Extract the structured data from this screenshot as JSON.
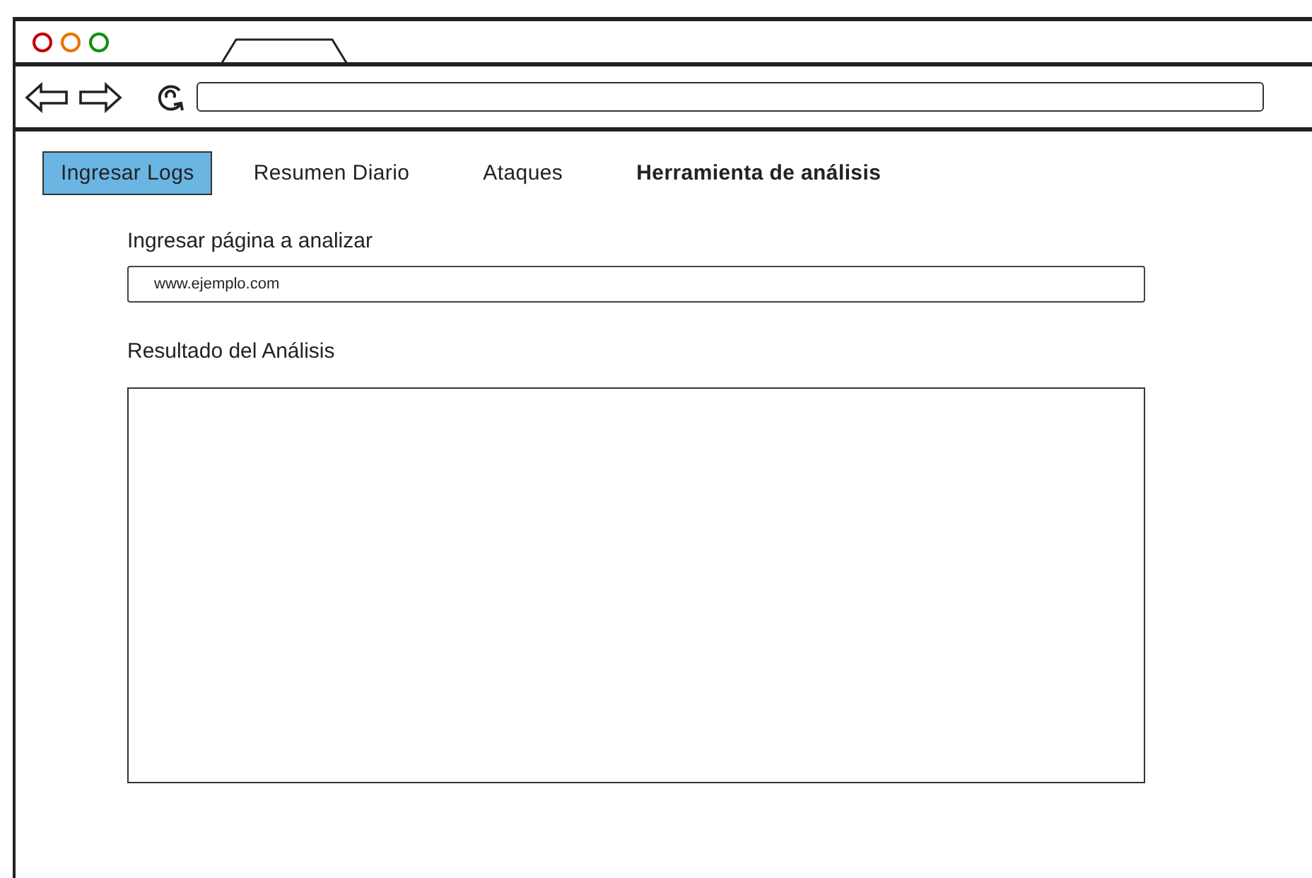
{
  "browser": {
    "controls": [
      {
        "color": "#c00000"
      },
      {
        "color": "#e87400"
      },
      {
        "color": "#109010"
      }
    ]
  },
  "tabs": [
    {
      "label": "Ingresar Logs",
      "selected": true,
      "kind": "plain"
    },
    {
      "label": "Resumen Diario",
      "selected": false,
      "kind": "plain"
    },
    {
      "label": "Ataques",
      "selected": false,
      "kind": "plain"
    },
    {
      "label": "Herramienta de análisis",
      "selected": false,
      "kind": "strong"
    }
  ],
  "form": {
    "url_label": "Ingresar página a analizar",
    "url_value": "www.ejemplo.com",
    "result_label": "Resultado del Análisis"
  }
}
